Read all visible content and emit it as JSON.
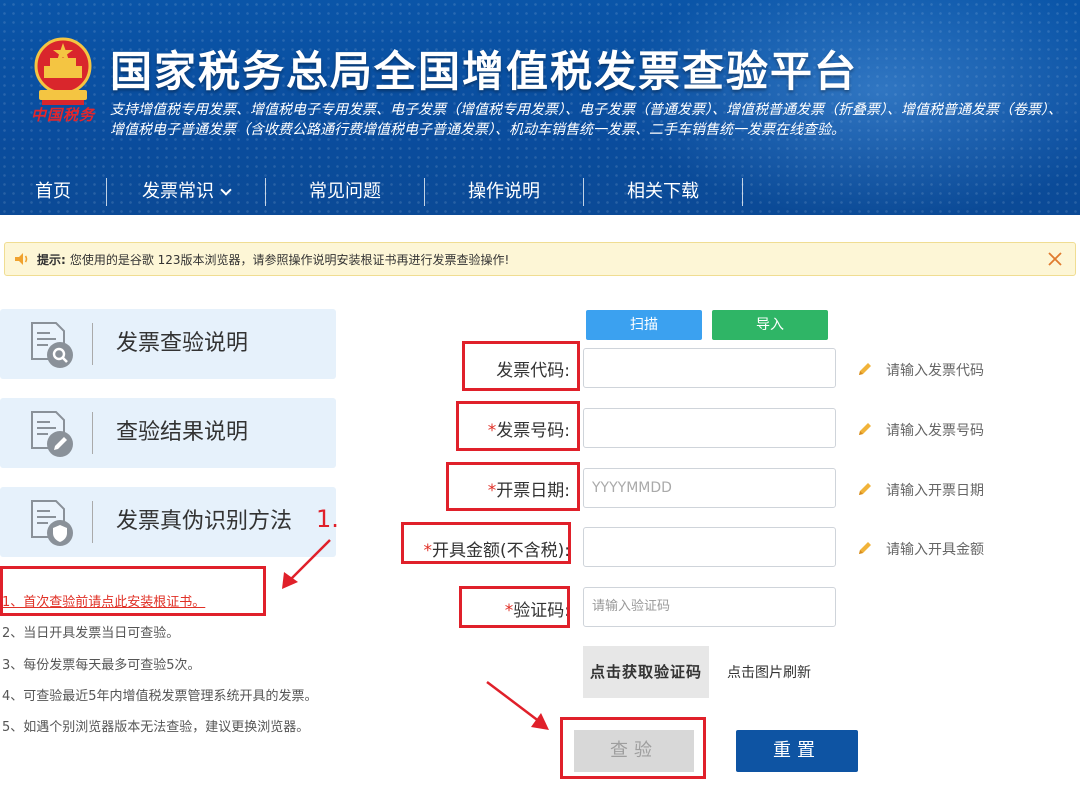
{
  "header": {
    "emblem_caption": "中国税务",
    "title": "国家税务总局全国增值税发票查验平台",
    "subtitle": "支持增值税专用发票、增值税电子专用发票、电子发票（增值税专用发票）、电子发票（普通发票）、增值税普通发票（折叠票）、增值税普通发票（卷票）、增值税电子普通发票（含收费公路通行费增值税电子普通发票）、机动车销售统一发票、二手车销售统一发票在线查验。",
    "nav": [
      {
        "label": "首页"
      },
      {
        "label": "发票常识"
      },
      {
        "label": "常见问题"
      },
      {
        "label": "操作说明"
      },
      {
        "label": "相关下载"
      }
    ]
  },
  "tip": {
    "prefix": "提示:",
    "text": "您使用的是谷歌 123版本浏览器，请参照操作说明安装根证书再进行发票查验操作!"
  },
  "side_cards": [
    {
      "label": "发票查验说明",
      "icon": "magnify-doc-icon"
    },
    {
      "label": "查验结果说明",
      "icon": "edit-doc-icon"
    },
    {
      "label": "发票真伪识别方法",
      "icon": "shield-doc-icon"
    }
  ],
  "notes": [
    "1、首次查验前请点此安装根证书。",
    "2、当日开具发票当日可查验。",
    "3、每份发票每天最多可查验5次。",
    "4、可查验最近5年内增值税发票管理系统开具的发票。",
    "5、如遇个别浏览器版本无法查验，建议更换浏览器。"
  ],
  "form": {
    "scan_label": "扫描",
    "import_label": "导入",
    "fields": [
      {
        "label": "发票代码:",
        "required": false,
        "value": "",
        "placeholder": "",
        "hint": "请输入发票代码"
      },
      {
        "label": "发票号码:",
        "required": true,
        "value": "",
        "placeholder": "",
        "hint": "请输入发票号码"
      },
      {
        "label": "开票日期:",
        "required": true,
        "value": "",
        "placeholder": "YYYYMMDD",
        "hint": "请输入开票日期"
      },
      {
        "label": "开具金额(不含税):",
        "required": true,
        "value": "",
        "placeholder": "",
        "hint": "请输入开具金额"
      },
      {
        "label": "验证码:",
        "required": true,
        "value": "",
        "placeholder": "请输入验证码",
        "hint": ""
      }
    ],
    "captcha_text": "点击获取验证码",
    "captcha_tip": "点击图片刷新",
    "query_label": "查验",
    "reset_label": "重置"
  },
  "annotation": {
    "number": "1."
  },
  "colors": {
    "header_blue": "#0a55a8",
    "nav_text": "#ffffff",
    "tip_bg": "#fdf6d6",
    "card_bg": "#e6f1fb",
    "scan_btn": "#3ba1f0",
    "import_btn": "#2fb566",
    "reset_btn": "#0e54a3",
    "annotation_red": "#e0202a",
    "required_star": "#e03026"
  }
}
